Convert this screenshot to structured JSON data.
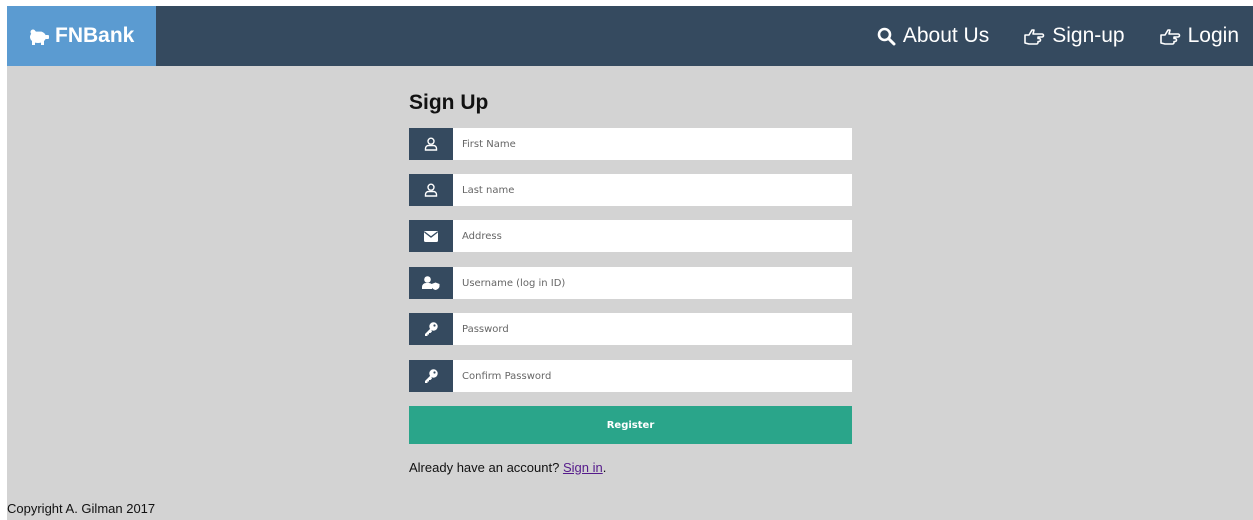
{
  "navbar": {
    "brand": "FNBank",
    "links": [
      {
        "label": "About Us",
        "icon": "search-icon"
      },
      {
        "label": "Sign-up",
        "icon": "hand-pointing-icon"
      },
      {
        "label": "Login",
        "icon": "hand-pointing-icon"
      }
    ]
  },
  "form": {
    "title": "Sign Up",
    "fields": [
      {
        "placeholder": "First Name",
        "icon": "user-icon"
      },
      {
        "placeholder": "Last name",
        "icon": "user-icon"
      },
      {
        "placeholder": "Address",
        "icon": "envelope-icon"
      },
      {
        "placeholder": "Username (log in ID)",
        "icon": "user-shield-icon"
      },
      {
        "placeholder": "Password",
        "icon": "key-icon"
      },
      {
        "placeholder": "Confirm Password",
        "icon": "key-icon"
      }
    ],
    "register_label": "Register",
    "signin_prefix": "Already have an account?",
    "signin_link": "Sign in",
    "signin_suffix": "."
  },
  "footer": {
    "copyright": "Copyright A. Gilman 2017"
  },
  "colors": {
    "navbar": "#354a5f",
    "brand_bg": "#5b9bd1",
    "register": "#2aa58a",
    "background": "#d3d3d3"
  }
}
